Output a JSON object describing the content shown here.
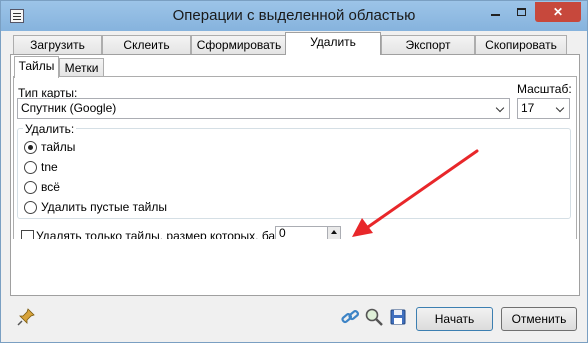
{
  "window": {
    "title": "Операции с выделенной областью"
  },
  "main_tabs": [
    {
      "label": "Загрузить"
    },
    {
      "label": "Склеить"
    },
    {
      "label": "Сформировать"
    },
    {
      "label": "Удалить",
      "active": true
    },
    {
      "label": "Экспорт"
    },
    {
      "label": "Скопировать"
    }
  ],
  "sub_tabs": [
    {
      "label": "Тайлы",
      "active": true
    },
    {
      "label": "Метки"
    }
  ],
  "map_type": {
    "label": "Тип карты:",
    "value": "Спутник (Google)"
  },
  "scale": {
    "label": "Масштаб:",
    "value": "17"
  },
  "delete_group": {
    "title": "Удалить:",
    "options": [
      {
        "label": "тайлы",
        "checked": true
      },
      {
        "label": "tne",
        "checked": false
      },
      {
        "label": "всё",
        "checked": false
      },
      {
        "label": "Удалить пустые тайлы",
        "checked": false
      }
    ]
  },
  "size_filter": {
    "label": "Удалять только тайлы, размер которых, байт",
    "value": "0"
  },
  "buttons": {
    "start": "Начать",
    "cancel": "Отменить"
  },
  "icons": {
    "pin": "pin-icon",
    "link": "link-icon",
    "zoom": "zoom-icon",
    "save": "save-icon",
    "annotation_arrow": "red-arrow"
  },
  "colors": {
    "titlebar": "#8fbbe2",
    "close_button": "#c7483c",
    "annotation_arrow": "#e8272a"
  }
}
